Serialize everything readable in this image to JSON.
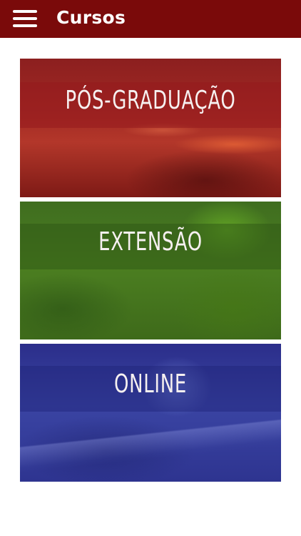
{
  "header": {
    "title": "Cursos",
    "background": "#7a0a0a"
  },
  "courses": [
    {
      "label": "PÓS-GRADUAÇÃO",
      "color": "#a32a24"
    },
    {
      "label": "EXTENSÃO",
      "color": "#4c7f21"
    },
    {
      "label": "ONLINE",
      "color": "#3a44a3"
    }
  ]
}
